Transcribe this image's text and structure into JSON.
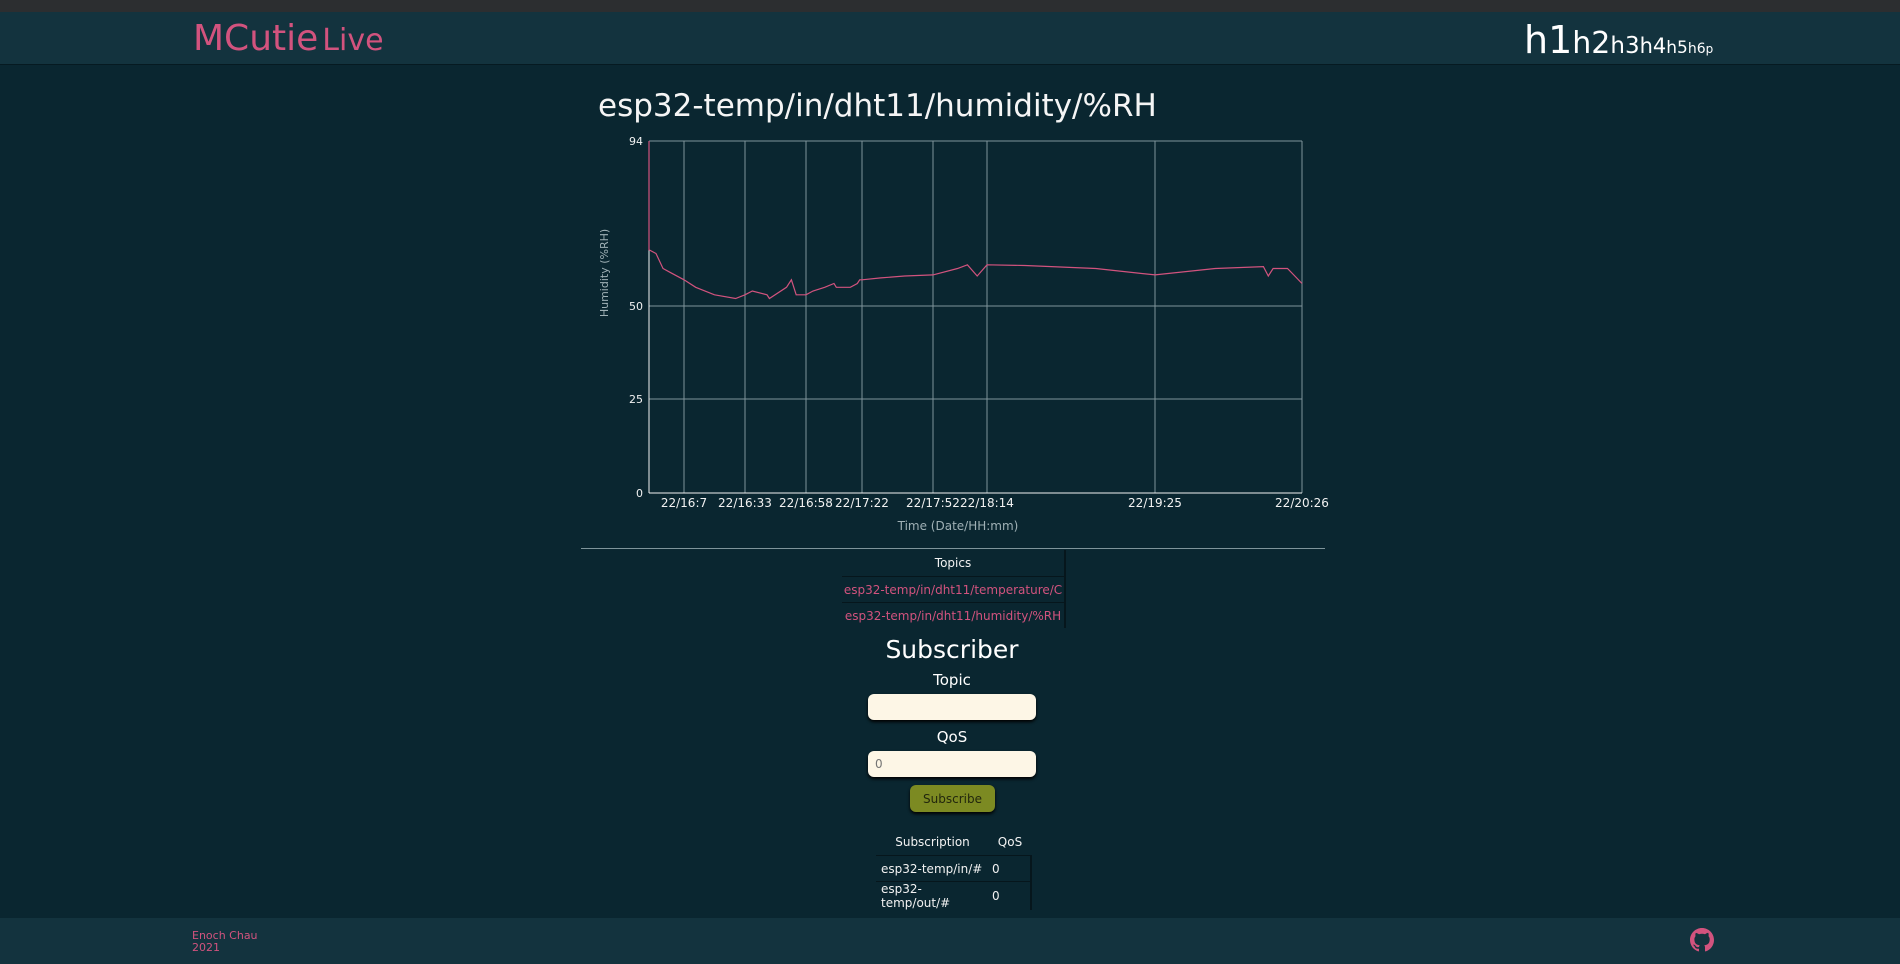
{
  "header": {
    "brand": "MCutie",
    "brand_suffix": "Live",
    "heading_sizes": [
      "h1",
      "h2",
      "h3",
      "h4",
      "h5",
      "h6",
      "p"
    ]
  },
  "chart": {
    "title": "esp32-temp/in/dht11/humidity/%RH",
    "line_color": "#d2537e",
    "grid_color": "#7f949a"
  },
  "chart_data": {
    "type": "line",
    "title": "esp32-temp/in/dht11/humidity/%RH",
    "xlabel": "Time (Date/HH:mm)",
    "ylabel": "Humidity (%RH)",
    "ylim": [
      0,
      94
    ],
    "y_ticks": [
      0,
      25,
      50,
      94
    ],
    "x_ticks": [
      "22/16:7",
      "22/16:33",
      "22/16:58",
      "22/17:22",
      "22/17:52",
      "22/18:14",
      "22/19:25",
      "22/20:26"
    ],
    "grid": true,
    "series": [
      {
        "x": [
          "22/16:2",
          "22/16:2",
          "22/16:3",
          "22/16:4",
          "22/16:5",
          "22/16:7",
          "22/16:12",
          "22/16:20",
          "22/16:29",
          "22/16:33",
          "22/16:36",
          "22/16:42",
          "22/16:43",
          "22/16:50",
          "22/16:52",
          "22/16:54",
          "22/16:57",
          "22/16:58",
          "22/17:1",
          "22/17:6",
          "22/17:10",
          "22/17:11",
          "22/17:17",
          "22/17:20",
          "22/17:21",
          "22/17:22",
          "22/17:30",
          "22/17:40",
          "22/17:52",
          "22/18:2",
          "22/18:6",
          "22/18:10",
          "22/18:14",
          "22/18:30",
          "22/19:0",
          "22/19:25",
          "22/19:50",
          "22/20:10",
          "22/20:12",
          "22/20:14",
          "22/20:20",
          "22/20:23",
          "22/20:26"
        ],
        "y": [
          94,
          65,
          64,
          60,
          59,
          57,
          55,
          53,
          52,
          53,
          54,
          53,
          52,
          55,
          57,
          53,
          53,
          53,
          54,
          55,
          56,
          55,
          55,
          56,
          57,
          57,
          57.5,
          58,
          58.3,
          60,
          61,
          58,
          61,
          60.8,
          60,
          58.3,
          60,
          60.5,
          58,
          60,
          60,
          58,
          56
        ]
      }
    ]
  },
  "topics": {
    "header": "Topics",
    "items": [
      "esp32-temp/in/dht11/temperature/C",
      "esp32-temp/in/dht11/humidity/%RH"
    ]
  },
  "subscriber": {
    "title": "Subscriber",
    "topic_label": "Topic",
    "topic_value": "",
    "qos_label": "QoS",
    "qos_placeholder": "0",
    "button": "Subscribe"
  },
  "subscriptions": {
    "headers": [
      "Subscription",
      "QoS"
    ],
    "rows": [
      {
        "topic": "esp32-temp/in/#",
        "qos": "0"
      },
      {
        "topic": "esp32-temp/out/#",
        "qos": "0"
      }
    ]
  },
  "footer": {
    "author": "Enoch Chau",
    "year": "2021",
    "github_icon": "github-icon"
  }
}
